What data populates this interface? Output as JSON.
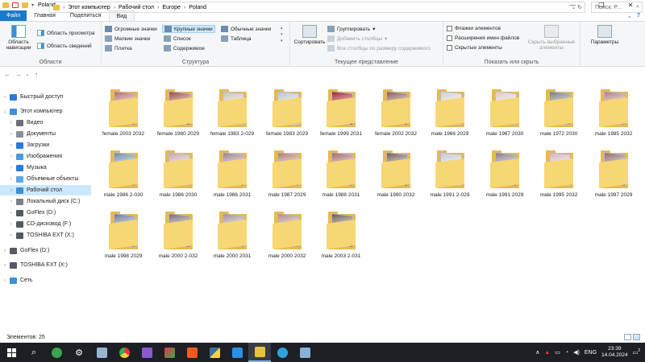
{
  "window": {
    "title": "Poland",
    "controls": [
      "—",
      "❐",
      "✕"
    ]
  },
  "tabs": [
    "Файл",
    "Главная",
    "Поделиться",
    "Вид"
  ],
  "ribbon": {
    "panels": {
      "label": "Области",
      "nav_pane": "Область навигации",
      "preview_pane": "Область просмотра",
      "details_pane": "Область сведений"
    },
    "layout": {
      "label": "Структура",
      "options": [
        "Огромные значки",
        "Крупные значки",
        "Обычные значки",
        "Мелкие значки",
        "Список",
        "Таблица",
        "Плитка",
        "Содержимое"
      ],
      "selected": "Крупные значки"
    },
    "current_view": {
      "label": "Текущее представление",
      "sort": "Сортировать",
      "group": "Группировать",
      "add_columns": "Добавить столбцы",
      "size_columns": "Все столбцы по размеру содержимого"
    },
    "show_hide": {
      "label": "Показать или скрыть",
      "item_checkboxes": "Флажки элементов",
      "file_extensions": "Расширения имен файлов",
      "hidden_items": "Скрытые элементы",
      "hide_selected": "Скрыть выбранные элементы"
    },
    "options": "Параметры"
  },
  "address": {
    "crumbs": [
      "Этот компьютер",
      "Рабочий стол",
      "Europe",
      "Poland"
    ],
    "search_placeholder": "Поиск: P..."
  },
  "nav": [
    {
      "label": "Быстрый доступ",
      "icon": "star-icon",
      "color": "#2b7bd6",
      "indent": 0,
      "chev": "›"
    },
    {
      "label": "Этот компьютер",
      "icon": "computer-icon",
      "color": "#3b8fd9",
      "indent": 0,
      "chev": "⌄"
    },
    {
      "label": "Видео",
      "icon": "video-icon",
      "color": "#6a6f78",
      "indent": 1,
      "chev": "›"
    },
    {
      "label": "Документы",
      "icon": "documents-icon",
      "color": "#8a8f98",
      "indent": 1,
      "chev": "›"
    },
    {
      "label": "Загрузки",
      "icon": "downloads-icon",
      "color": "#2b7bd6",
      "indent": 1,
      "chev": "›"
    },
    {
      "label": "Изображения",
      "icon": "pictures-icon",
      "color": "#4a9be0",
      "indent": 1,
      "chev": "›"
    },
    {
      "label": "Музыка",
      "icon": "music-icon",
      "color": "#2b7bd6",
      "indent": 1,
      "chev": "›"
    },
    {
      "label": "Объемные объекты",
      "icon": "3d-objects-icon",
      "color": "#5aa8e8",
      "indent": 1,
      "chev": "›"
    },
    {
      "label": "Рабочий стол",
      "icon": "desktop-icon",
      "color": "#3b8fd9",
      "indent": 1,
      "chev": "›",
      "selected": true
    },
    {
      "label": "Локальный диск (C:)",
      "icon": "drive-icon",
      "color": "#7a7f88",
      "indent": 1,
      "chev": "›"
    },
    {
      "label": "GoFlex  (D:)",
      "icon": "drive-icon",
      "color": "#555a62",
      "indent": 1,
      "chev": "›"
    },
    {
      "label": "CD-дисковод (F:)",
      "icon": "cd-drive-icon",
      "color": "#555a62",
      "indent": 1,
      "chev": "›"
    },
    {
      "label": "TOSHIBA EXT (X:)",
      "icon": "drive-icon",
      "color": "#555a62",
      "indent": 1,
      "chev": "›"
    },
    {
      "label": "GoFlex  (D:)",
      "icon": "drive-icon",
      "color": "#555a62",
      "indent": 0,
      "chev": "›"
    },
    {
      "label": "TOSHIBA EXT (X:)",
      "icon": "drive-icon",
      "color": "#555a62",
      "indent": 0,
      "chev": "›"
    },
    {
      "label": "Сеть",
      "icon": "network-icon",
      "color": "#3b8fd9",
      "indent": 0,
      "chev": "›"
    }
  ],
  "folders": [
    {
      "name": "female  2003 2032",
      "color": "#b46a6a"
    },
    {
      "name": "female 1980 2029",
      "color": "#9a4a3e"
    },
    {
      "name": "female 1983 2-029",
      "color": "#c9bfb6"
    },
    {
      "name": "female 1983 2029",
      "color": "#b9c2d0"
    },
    {
      "name": "female 1999 2031",
      "color": "#a02030"
    },
    {
      "name": "female 2002 2032",
      "color": "#8a5a50"
    },
    {
      "name": "male 1966 2029",
      "color": "#d0d0cc"
    },
    {
      "name": "male 1967 2030",
      "color": "#d8c8cc"
    },
    {
      "name": "male 1972 2030",
      "color": "#7a7a80"
    },
    {
      "name": "male 1985 2032",
      "color": "#b08080"
    },
    {
      "name": "male 1986 2-030",
      "color": "#6a8aaa"
    },
    {
      "name": "male 1986 2030",
      "color": "#c8a8b0"
    },
    {
      "name": "male 1986 2031",
      "color": "#9a8090"
    },
    {
      "name": "male 1987 2029",
      "color": "#b07a70"
    },
    {
      "name": "male 1988 2031",
      "color": "#a06868"
    },
    {
      "name": "male 1990 2032",
      "color": "#705a58"
    },
    {
      "name": "male 1991 2-029",
      "color": "#c0c8d0"
    },
    {
      "name": "male 1991 2029",
      "color": "#8a7a8a"
    },
    {
      "name": "male 1995 2032",
      "color": "#d2b4b8"
    },
    {
      "name": "male 1997 2029",
      "color": "#8a6a6a"
    },
    {
      "name": "male 1998 2029",
      "color": "#6a7a9a"
    },
    {
      "name": "male 2000 2-032",
      "color": "#7a6a70"
    },
    {
      "name": "male 2000 2031",
      "color": "#a09098"
    },
    {
      "name": "male 2000 2032",
      "color": "#b48888"
    },
    {
      "name": "male 2003 2-031",
      "color": "#6a5a50"
    }
  ],
  "status": {
    "count": "Элементов: 25"
  },
  "taskbar": {
    "lang": "ENG",
    "time": "23:39",
    "date": "14.04.2024",
    "notif_count": "2"
  }
}
